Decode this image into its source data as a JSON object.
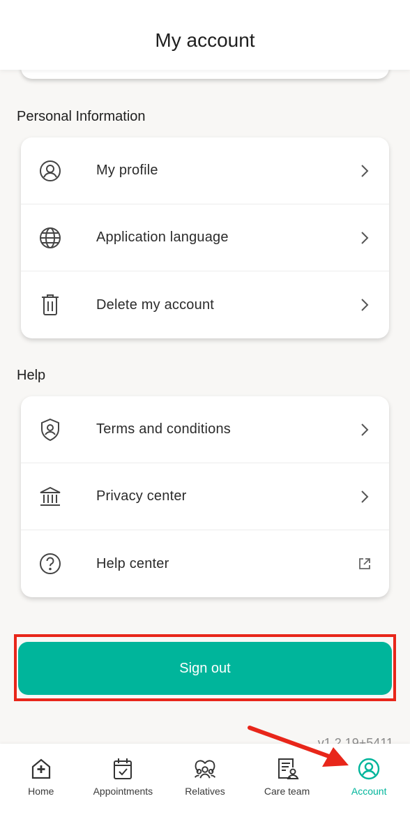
{
  "header": {
    "title": "My account"
  },
  "personal": {
    "title": "Personal Information",
    "items": [
      {
        "label": "My profile",
        "icon": "user-circle-icon",
        "trailing": "chevron-right-icon"
      },
      {
        "label": "Application language",
        "icon": "globe-icon",
        "trailing": "chevron-right-icon"
      },
      {
        "label": "Delete my account",
        "icon": "trash-icon",
        "trailing": "chevron-right-icon"
      }
    ]
  },
  "help": {
    "title": "Help",
    "items": [
      {
        "label": "Terms and conditions",
        "icon": "shield-user-icon",
        "trailing": "chevron-right-icon"
      },
      {
        "label": "Privacy center",
        "icon": "bank-icon",
        "trailing": "chevron-right-icon"
      },
      {
        "label": "Help center",
        "icon": "question-circle-icon",
        "trailing": "external-link-icon"
      }
    ]
  },
  "signout": {
    "label": "Sign out"
  },
  "version": "v1.2.19+5411",
  "tabs": [
    {
      "label": "Home",
      "icon": "home-plus-icon",
      "active": false
    },
    {
      "label": "Appointments",
      "icon": "calendar-check-icon",
      "active": false
    },
    {
      "label": "Relatives",
      "icon": "relatives-icon",
      "active": false
    },
    {
      "label": "Care team",
      "icon": "care-team-icon",
      "active": false
    },
    {
      "label": "Account",
      "icon": "account-icon",
      "active": true
    }
  ],
  "colors": {
    "accent": "#00b59b",
    "annotation": "#e8261a",
    "background": "#f8f7f5"
  }
}
